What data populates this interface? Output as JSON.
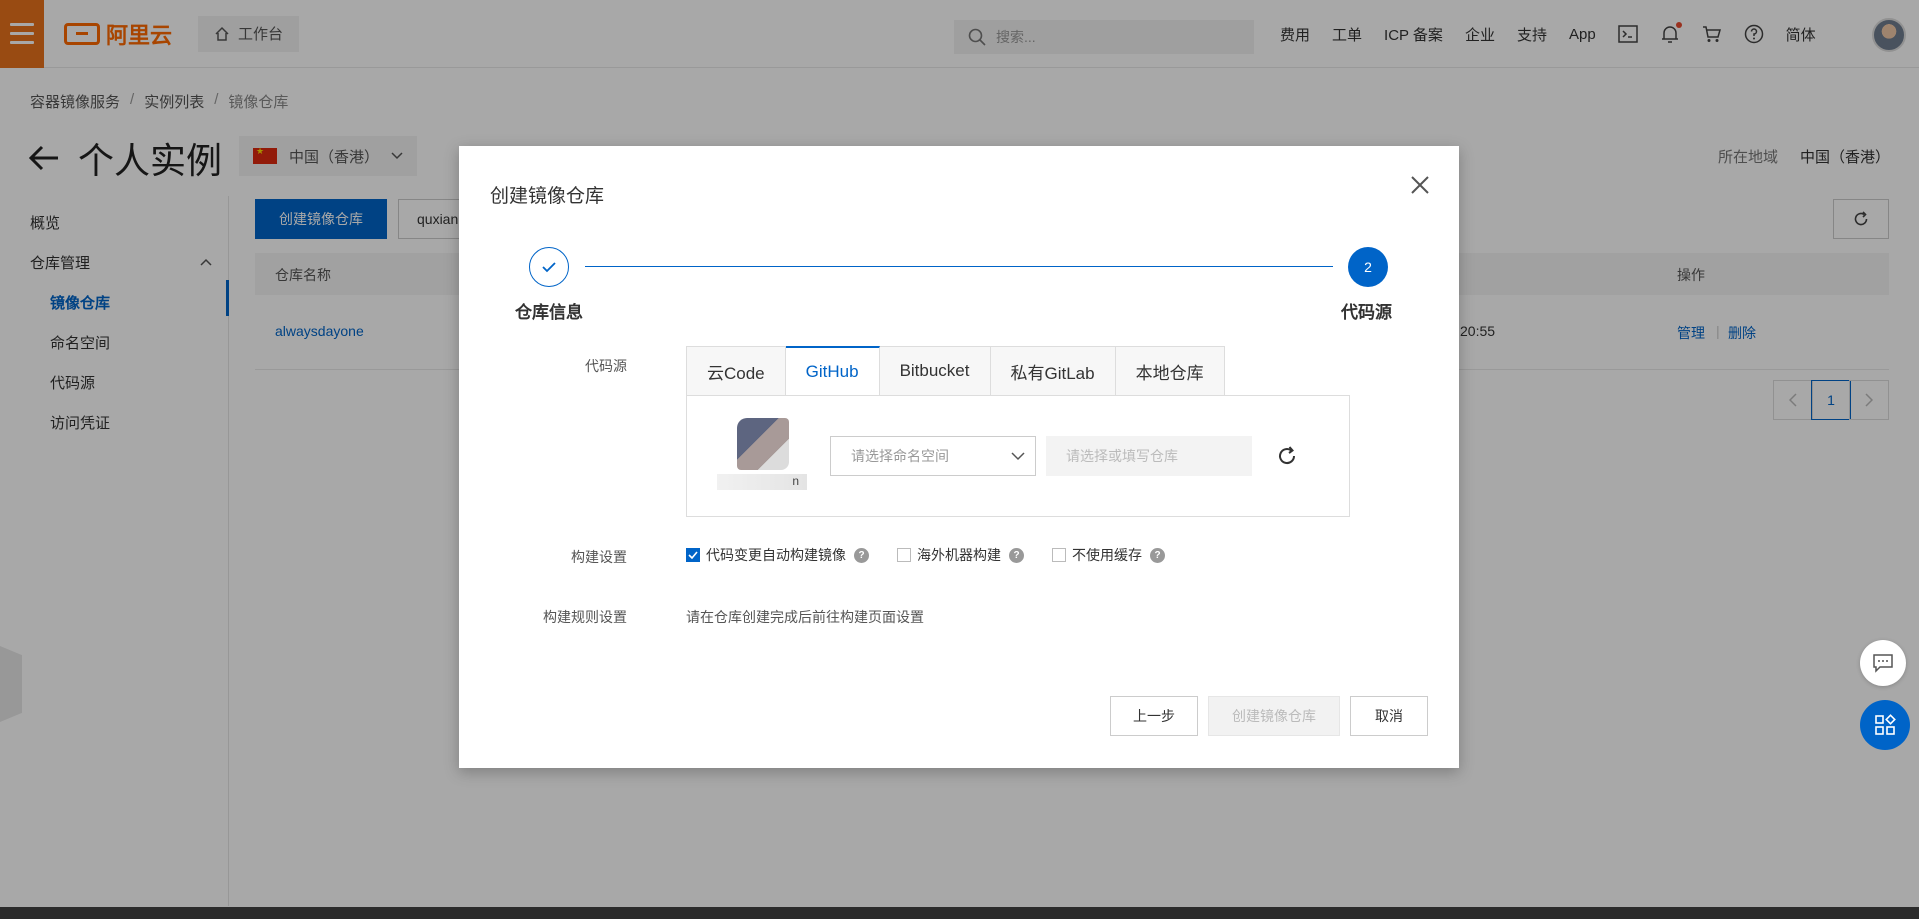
{
  "topbar": {
    "brand": "阿里云",
    "workbench": "工作台",
    "search_placeholder": "搜索...",
    "links": [
      "费用",
      "工单",
      "ICP 备案",
      "企业",
      "支持",
      "App"
    ],
    "language": "简体"
  },
  "breadcrumb": [
    "容器镜像服务",
    "实例列表",
    "镜像仓库"
  ],
  "page": {
    "title": "个人实例",
    "region": "中国（香港）",
    "region_label": "所在地域",
    "region_value": "中国（香港）"
  },
  "sidebar": {
    "overview": "概览",
    "group": "仓库管理",
    "items": [
      "镜像仓库",
      "命名空间",
      "代码源",
      "访问凭证"
    ]
  },
  "main": {
    "create_button": "创建镜像仓库",
    "filter_value": "quxian",
    "col_name": "仓库名称",
    "col_action": "操作",
    "row": {
      "name": "alwaysdayone",
      "time": "20:55",
      "manage": "管理",
      "delete": "删除"
    },
    "page_current": "1"
  },
  "modal": {
    "title": "创建镜像仓库",
    "step1_label": "仓库信息",
    "step2_number": "2",
    "step2_label": "代码源",
    "source_label": "代码源",
    "tabs": [
      "云Code",
      "GitHub",
      "Bitbucket",
      "私有GitLab",
      "本地仓库"
    ],
    "active_tab": "GitHub",
    "account_suffix": "n",
    "namespace_placeholder": "请选择命名空间",
    "repo_placeholder": "请选择或填写仓库",
    "build_label": "构建设置",
    "build_options": [
      {
        "label": "代码变更自动构建镜像",
        "checked": true
      },
      {
        "label": "海外机器构建",
        "checked": false
      },
      {
        "label": "不使用缓存",
        "checked": false
      }
    ],
    "rule_label": "构建规则设置",
    "rule_text": "请在仓库创建完成后前往构建页面设置",
    "btn_prev": "上一步",
    "btn_create": "创建镜像仓库",
    "btn_cancel": "取消"
  },
  "colors": {
    "brand_orange": "#ff6a00",
    "primary_blue": "#0064c8"
  }
}
